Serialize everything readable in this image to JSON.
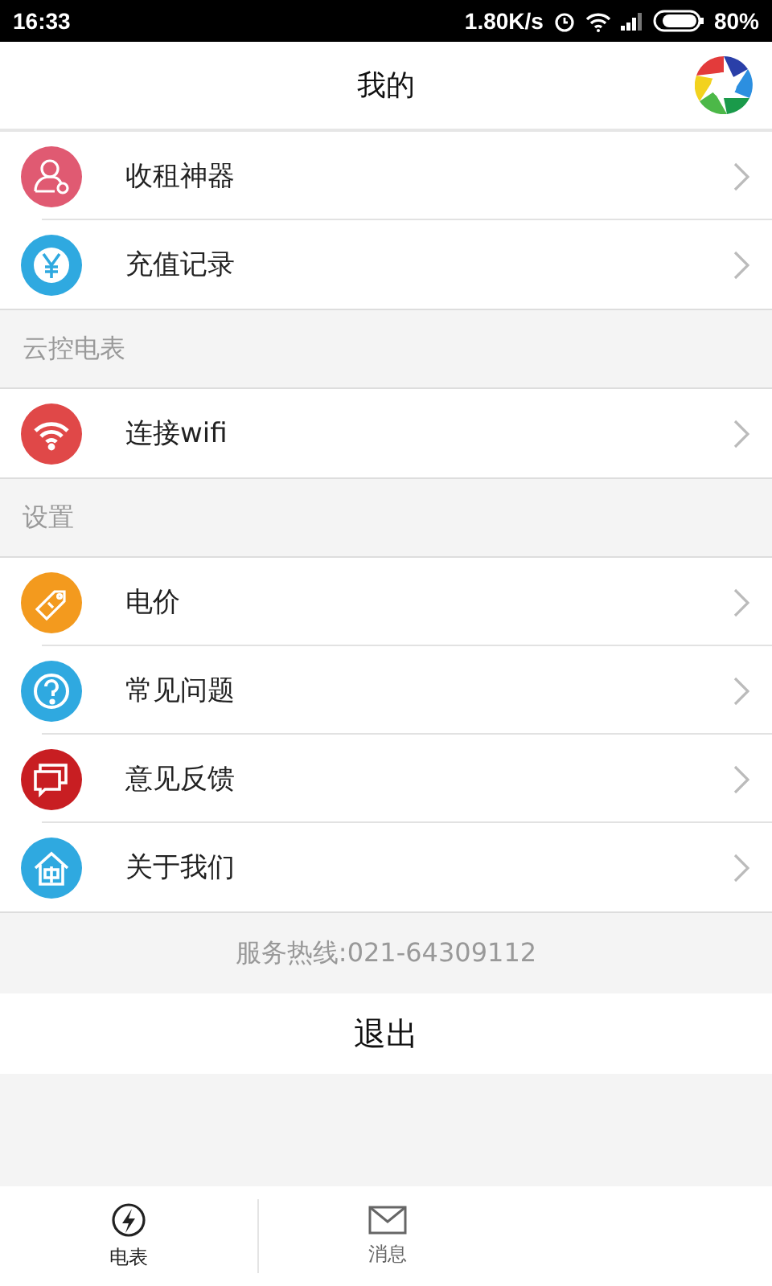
{
  "status_bar": {
    "time": "16:33",
    "speed": "1.80K/s",
    "battery": "80%"
  },
  "header": {
    "title": "我的"
  },
  "groups": [
    {
      "items": [
        {
          "label": "收租神器",
          "color": "#e05a72"
        },
        {
          "label": "充值记录",
          "color": "#2fa9e0"
        }
      ]
    },
    {
      "heading": "云控电表",
      "items": [
        {
          "label": "连接wifi",
          "color": "#e04848"
        }
      ]
    },
    {
      "heading": "设置",
      "items": [
        {
          "label": "电价",
          "color": "#f39a1e"
        },
        {
          "label": "常见问题",
          "color": "#2fa9e0"
        },
        {
          "label": "意见反馈",
          "color": "#c81e22"
        },
        {
          "label": "关于我们",
          "color": "#2fa9e0"
        }
      ]
    }
  ],
  "hotline": "服务热线:021-64309112",
  "logout": "退出",
  "tabs": [
    {
      "label": "电表",
      "selected": true
    },
    {
      "label": "消息",
      "selected": false
    }
  ]
}
